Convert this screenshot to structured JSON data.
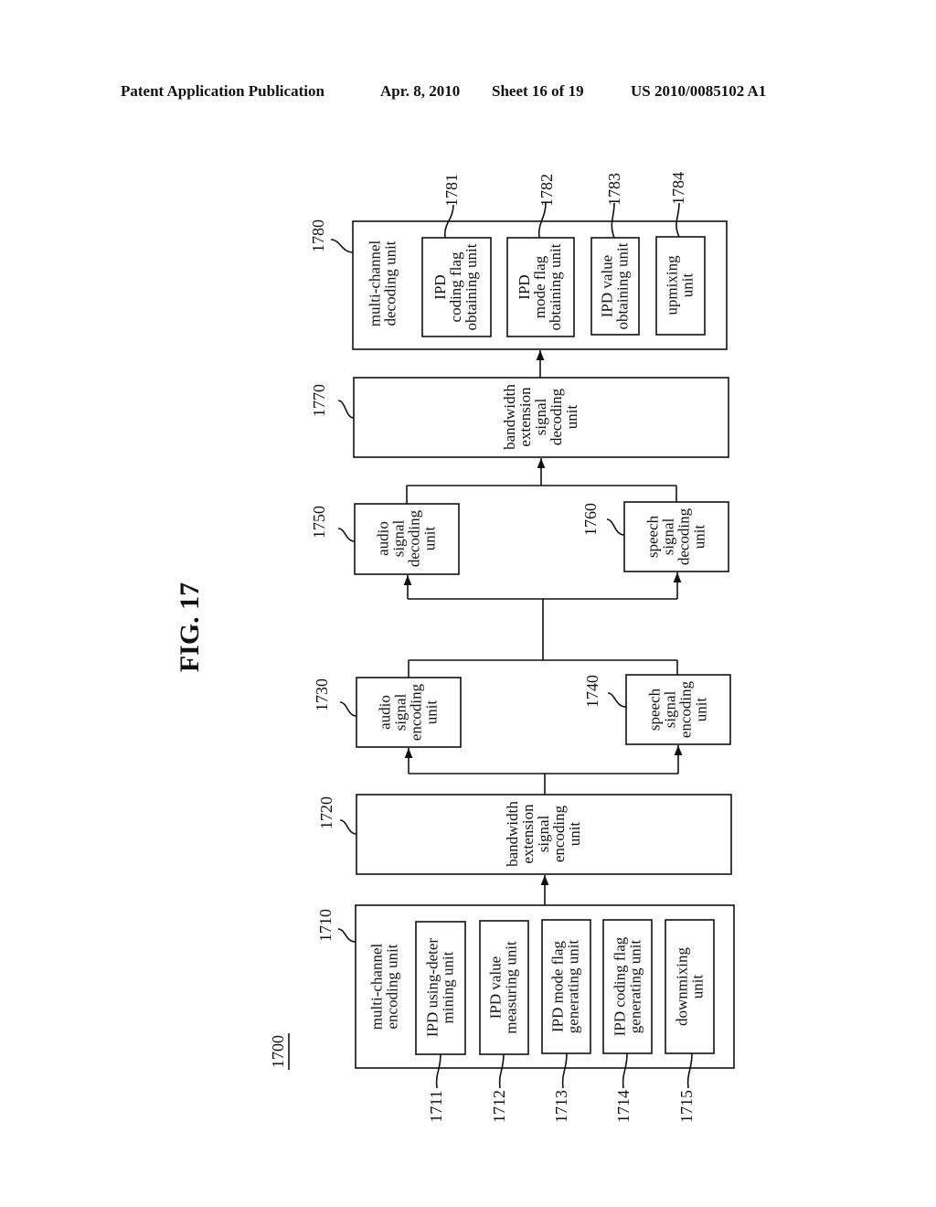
{
  "header": {
    "publication": "Patent Application Publication",
    "date": "Apr. 8, 2010",
    "sheet": "Sheet 16 of 19",
    "patent_number": "US 2010/0085102 A1"
  },
  "figure": {
    "title": "FIG. 17",
    "system_ref": "1700"
  },
  "blocks": {
    "b1710": {
      "ref": "1710",
      "lines": [
        "multi-channel",
        "encoding unit"
      ]
    },
    "b1711": {
      "ref": "1711",
      "lines": [
        "IPD using-deter",
        "mining unit"
      ]
    },
    "b1712": {
      "ref": "1712",
      "lines": [
        "IPD value",
        "measuring unit"
      ]
    },
    "b1713": {
      "ref": "1713",
      "lines": [
        "IPD mode flag",
        "generating unit"
      ]
    },
    "b1714": {
      "ref": "1714",
      "lines": [
        "IPD coding flag",
        "generating unit"
      ]
    },
    "b1715": {
      "ref": "1715",
      "lines": [
        "downmixing",
        "unit"
      ]
    },
    "b1720": {
      "ref": "1720",
      "lines": [
        "bandwidth",
        "extension",
        "signal",
        "encoding",
        "unit"
      ]
    },
    "b1730": {
      "ref": "1730",
      "lines": [
        "audio",
        "signal",
        "encoding",
        "unit"
      ]
    },
    "b1740": {
      "ref": "1740",
      "lines": [
        "speech",
        "signal",
        "encoding",
        "unit"
      ]
    },
    "b1750": {
      "ref": "1750",
      "lines": [
        "audio",
        "signal",
        "decoding",
        "unit"
      ]
    },
    "b1760": {
      "ref": "1760",
      "lines": [
        "speech",
        "signal",
        "decoding",
        "unit"
      ]
    },
    "b1770": {
      "ref": "1770",
      "lines": [
        "bandwidth",
        "extension",
        "signal",
        "decoding",
        "unit"
      ]
    },
    "b1780": {
      "ref": "1780",
      "lines": [
        "multi-channel",
        "decoding unit"
      ]
    },
    "b1781": {
      "ref": "1781",
      "lines": [
        "IPD",
        "coding flag",
        "obtaining unit"
      ]
    },
    "b1782": {
      "ref": "1782",
      "lines": [
        "IPD",
        "mode flag",
        "obtaining unit"
      ]
    },
    "b1783": {
      "ref": "1783",
      "lines": [
        "IPD value",
        "obtaining unit"
      ]
    },
    "b1784": {
      "ref": "1784",
      "lines": [
        "upmixing",
        "unit"
      ]
    }
  }
}
